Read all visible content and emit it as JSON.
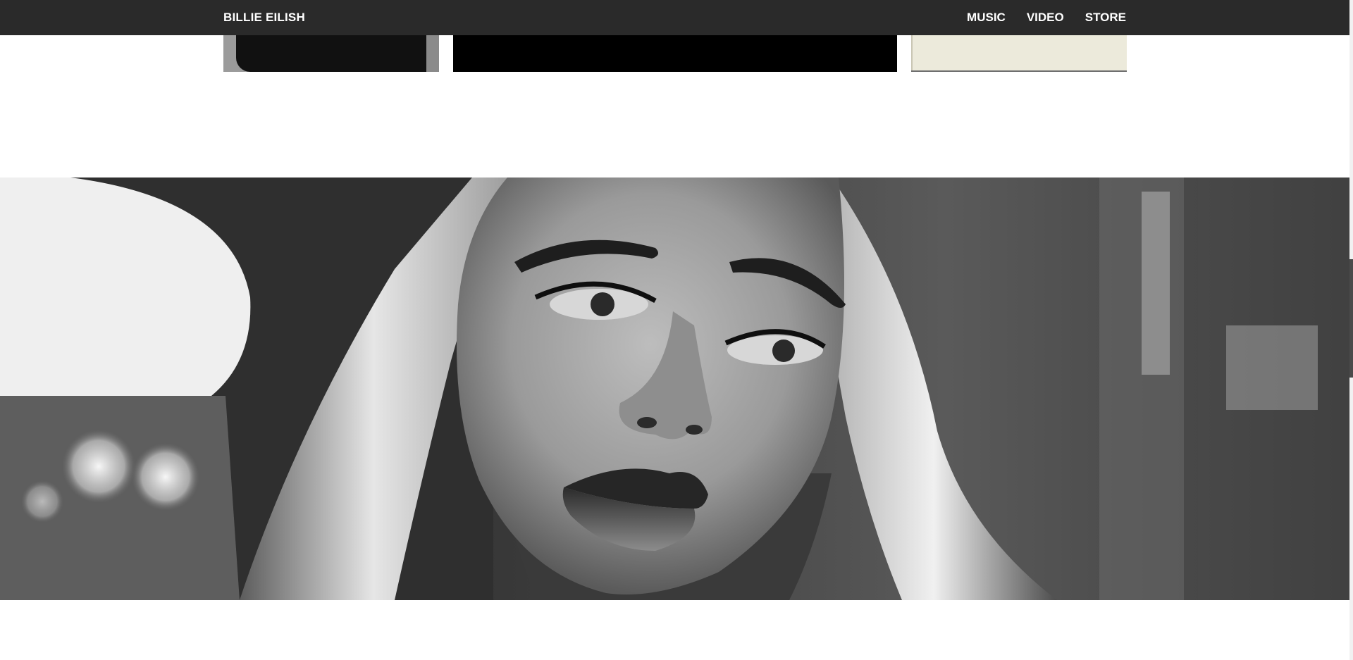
{
  "navbar": {
    "brand": "BILLIE EILISH",
    "links": [
      "MUSIC",
      "VIDEO",
      "STORE"
    ],
    "background_color": "#2a2a2a"
  },
  "gallery": {
    "tiles": [
      "photo",
      "video",
      "photo"
    ]
  },
  "hero": {
    "image_subject": "black-and-white portrait photo",
    "tone": "monochrome"
  },
  "colors": {
    "page_background": "#ffffff",
    "nav_text": "#ffffff"
  }
}
